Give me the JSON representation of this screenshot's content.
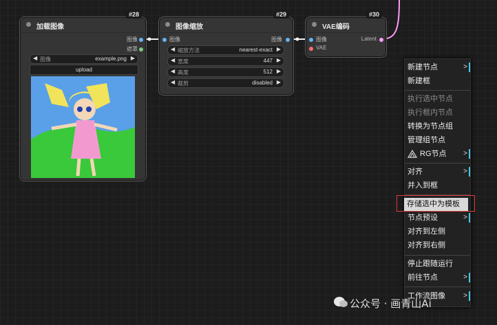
{
  "nodes": {
    "load_image": {
      "id": "#28",
      "title": "加载图像",
      "outputs": [
        "图像",
        "遮罩"
      ],
      "widget": {
        "label": "图像",
        "value": "example.png"
      },
      "upload": "upload"
    },
    "image_scale": {
      "id": "#29",
      "title": "图像缩放",
      "input": "图像",
      "output": "图像",
      "widgets": [
        {
          "label": "缩放方法",
          "value": "nearest-exact"
        },
        {
          "label": "宽度",
          "value": "447"
        },
        {
          "label": "高度",
          "value": "512"
        },
        {
          "label": "裁剪",
          "value": "disabled"
        }
      ]
    },
    "vae_encode": {
      "id": "#30",
      "title": "VAE编码",
      "inputs": [
        "图像",
        "VAE"
      ],
      "output": "Latent"
    }
  },
  "menu": {
    "items": [
      {
        "label": "新建节点",
        "sub": true
      },
      {
        "label": "新建框"
      },
      {
        "label": "执行选中节点",
        "disabled": true
      },
      {
        "label": "执行框内节点",
        "disabled": true
      },
      {
        "label": "转换为节点组"
      },
      {
        "label": "管理组节点"
      },
      {
        "label": "RG节点",
        "sub": true,
        "icon": true
      },
      {
        "label": "对齐",
        "sub": true
      },
      {
        "label": "并入到框"
      },
      {
        "label": "存储选中为模板",
        "highlight": true
      },
      {
        "label": "节点预设",
        "sub": true
      },
      {
        "label": "对齐到左侧"
      },
      {
        "label": "对齐到右侧"
      },
      {
        "label": "停止跟随运行"
      },
      {
        "label": "前往节点",
        "sub": true
      },
      {
        "label": "工作流图像",
        "sub": true
      }
    ],
    "sub_glyph": ">"
  },
  "watermark": {
    "text": "公众号 · 画青山Ai"
  },
  "colors": {
    "image_port": "#64b5f6",
    "mask_port": "#81c784",
    "latent_port": "#ff9cf9",
    "vae_port": "#ff6e6e",
    "highlight": "#d9d9d9",
    "red_box": "#e23b3b"
  }
}
